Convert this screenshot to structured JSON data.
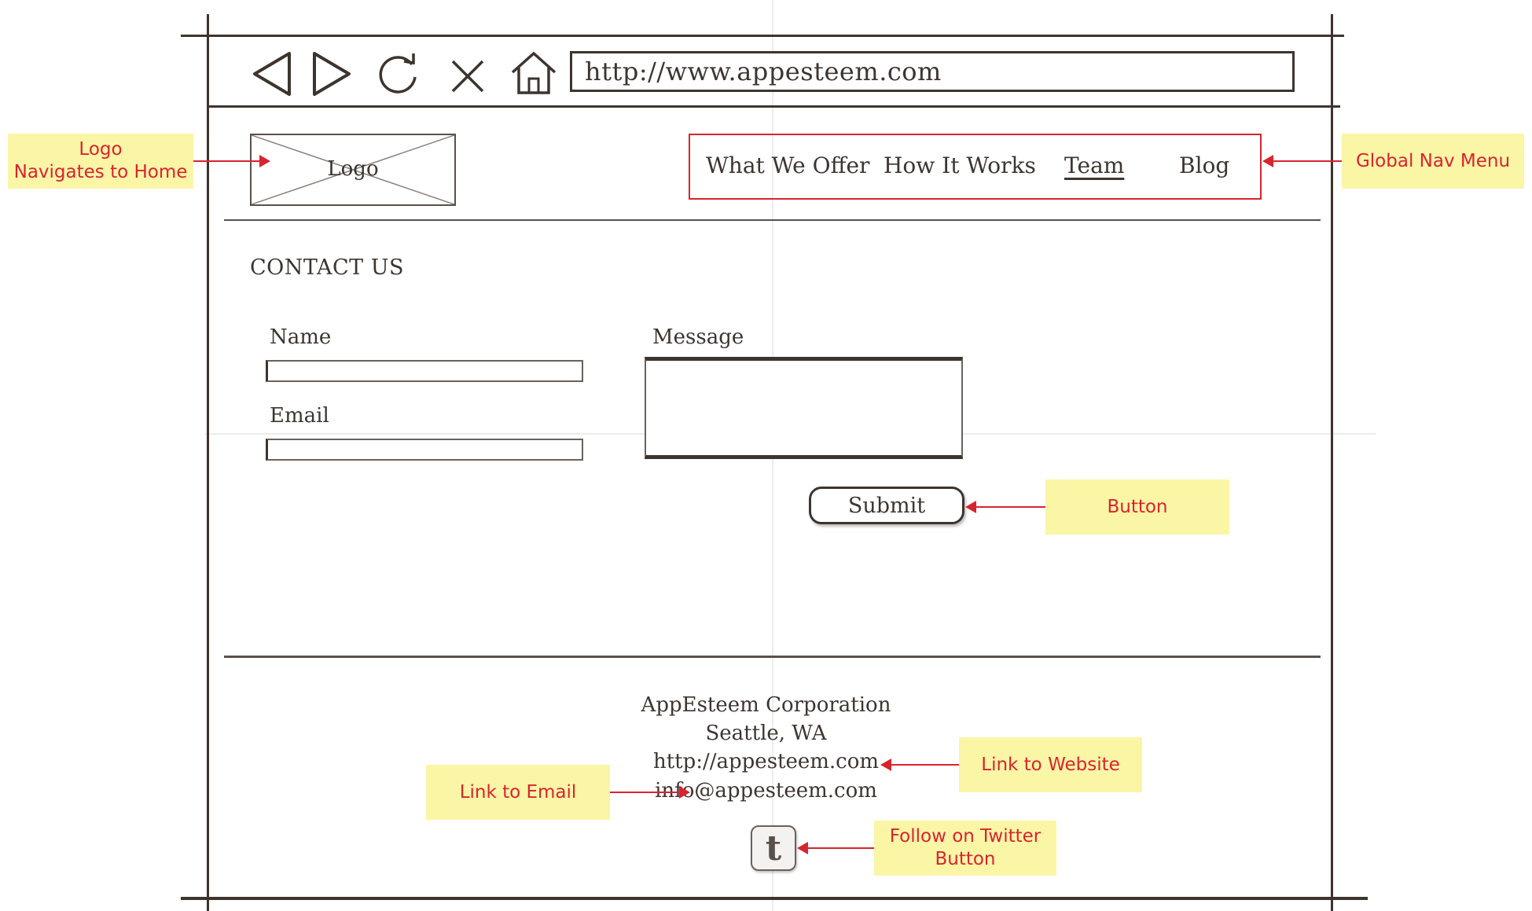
{
  "browser": {
    "back_icon": "back-arrow-icon",
    "forward_icon": "forward-arrow-icon",
    "reload_icon": "reload-icon",
    "stop_icon": "close-icon",
    "home_icon": "home-icon",
    "url": "http://www.appesteem.com"
  },
  "header": {
    "logo_label": "Logo",
    "nav": [
      {
        "label": "What We Offer"
      },
      {
        "label": "How It Works"
      },
      {
        "label": "Team",
        "active": true
      },
      {
        "label": "Blog"
      }
    ]
  },
  "main": {
    "heading": "CONTACT US",
    "name_label": "Name",
    "email_label": "Email",
    "message_label": "Message",
    "submit_label": "Submit"
  },
  "footer": {
    "company": "AppEsteem Corporation",
    "location": "Seattle, WA",
    "website": "http://appesteem.com",
    "email": "info@appesteem.com",
    "twitter_glyph": "t",
    "twitter_icon": "twitter-icon"
  },
  "annotations": {
    "logo_line1": "Logo",
    "logo_line2": "Navigates to Home",
    "global_nav": "Global Nav Menu",
    "button": "Button",
    "link_website": "Link to Website",
    "link_email": "Link to Email",
    "twitter_line1": "Follow on Twitter",
    "twitter_line2": "Button"
  },
  "colors": {
    "sketch_ink": "#3e342e",
    "annotation_fill": "#fbf5a6",
    "annotation_text": "#d8242f",
    "nav_outline": "#d8242f"
  }
}
